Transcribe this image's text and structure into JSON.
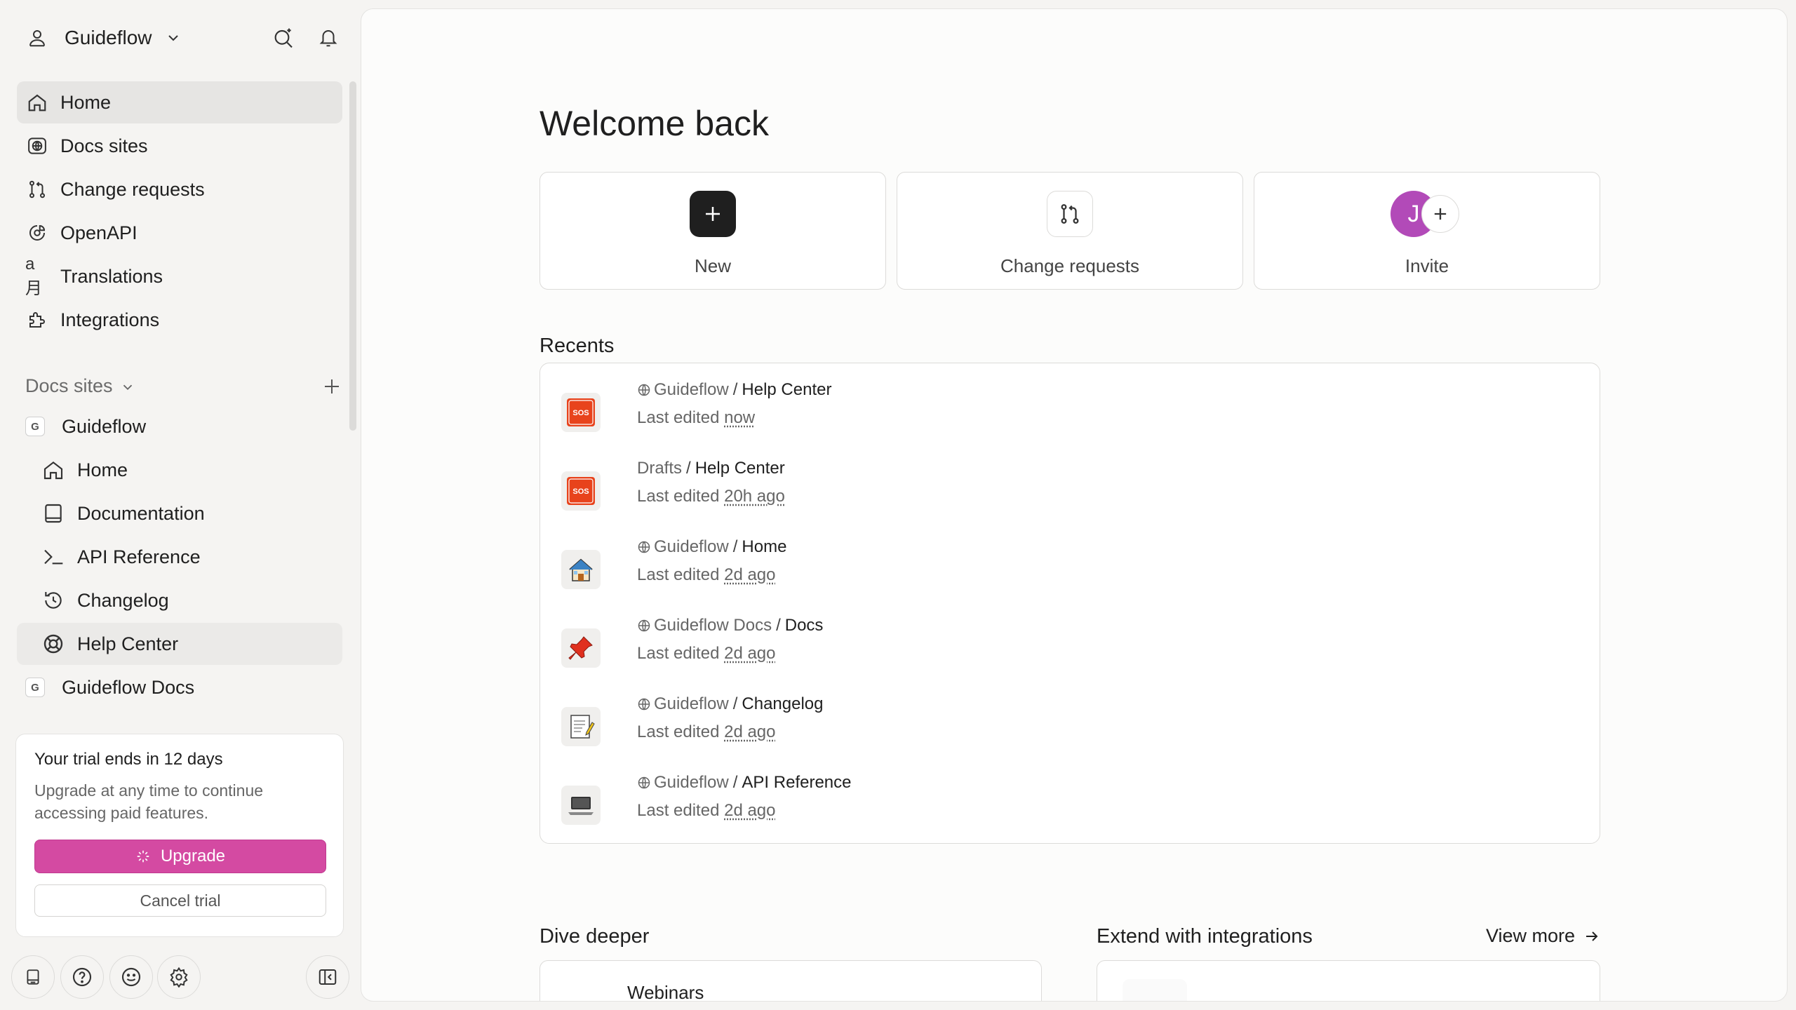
{
  "workspace": {
    "name": "Guideflow"
  },
  "nav": [
    {
      "label": "Home",
      "icon": "home-icon",
      "active": true
    },
    {
      "label": "Docs sites",
      "icon": "globe-box-icon"
    },
    {
      "label": "Change requests",
      "icon": "git-branch-icon"
    },
    {
      "label": "OpenAPI",
      "icon": "openapi-icon"
    },
    {
      "label": "Translations",
      "icon": "translate-icon",
      "glyph": "a月"
    },
    {
      "label": "Integrations",
      "icon": "puzzle-icon"
    }
  ],
  "docs_section": {
    "label": "Docs sites"
  },
  "sites": [
    {
      "label": "Guideflow",
      "badge": "G",
      "level": 0
    },
    {
      "label": "Home",
      "icon": "home-icon",
      "level": 1
    },
    {
      "label": "Documentation",
      "icon": "book-icon",
      "level": 1
    },
    {
      "label": "API Reference",
      "icon": "terminal-icon",
      "level": 1
    },
    {
      "label": "Changelog",
      "icon": "history-icon",
      "level": 1
    },
    {
      "label": "Help Center",
      "icon": "lifebuoy-icon",
      "level": 1,
      "active": true
    },
    {
      "label": "Guideflow Docs",
      "badge": "G",
      "level": 0
    }
  ],
  "trial": {
    "title": "Your trial ends in 12 days",
    "description": "Upgrade at any time to continue accessing paid features.",
    "upgrade_label": "Upgrade",
    "cancel_label": "Cancel trial"
  },
  "main": {
    "welcome": "Welcome back",
    "cards": {
      "new": "New",
      "change_requests": "Change requests",
      "invite": "Invite",
      "avatar_initial": "J"
    },
    "recents_title": "Recents",
    "recents": [
      {
        "space": "Guideflow",
        "globe": true,
        "page": "Help Center",
        "prefix": "Last edited",
        "when": "now",
        "thumb": "sos-icon"
      },
      {
        "space": "Drafts",
        "globe": false,
        "page": "Help Center",
        "prefix": "Last edited",
        "when": "20h ago",
        "thumb": "sos-icon"
      },
      {
        "space": "Guideflow",
        "globe": true,
        "page": "Home",
        "prefix": "Last edited",
        "when": "2d ago",
        "thumb": "house-emoji-icon"
      },
      {
        "space": "Guideflow Docs",
        "globe": true,
        "page": "Docs",
        "prefix": "Last edited",
        "when": "2d ago",
        "thumb": "pushpin-emoji-icon"
      },
      {
        "space": "Guideflow",
        "globe": true,
        "page": "Changelog",
        "prefix": "Last edited",
        "when": "2d ago",
        "thumb": "memo-emoji-icon"
      },
      {
        "space": "Guideflow",
        "globe": true,
        "page": "API Reference",
        "prefix": "Last edited",
        "when": "2d ago",
        "thumb": "laptop-emoji-icon"
      }
    ],
    "dive_title": "Dive deeper",
    "dive_card": "Webinars",
    "ext_title": "Extend with integrations",
    "view_more": "View more"
  },
  "colors": {
    "accent": "#d44aa2",
    "avatar": "#b24ab8",
    "sidebar_bg": "#f5f4f2",
    "active_bg": "#e6e5e3"
  }
}
